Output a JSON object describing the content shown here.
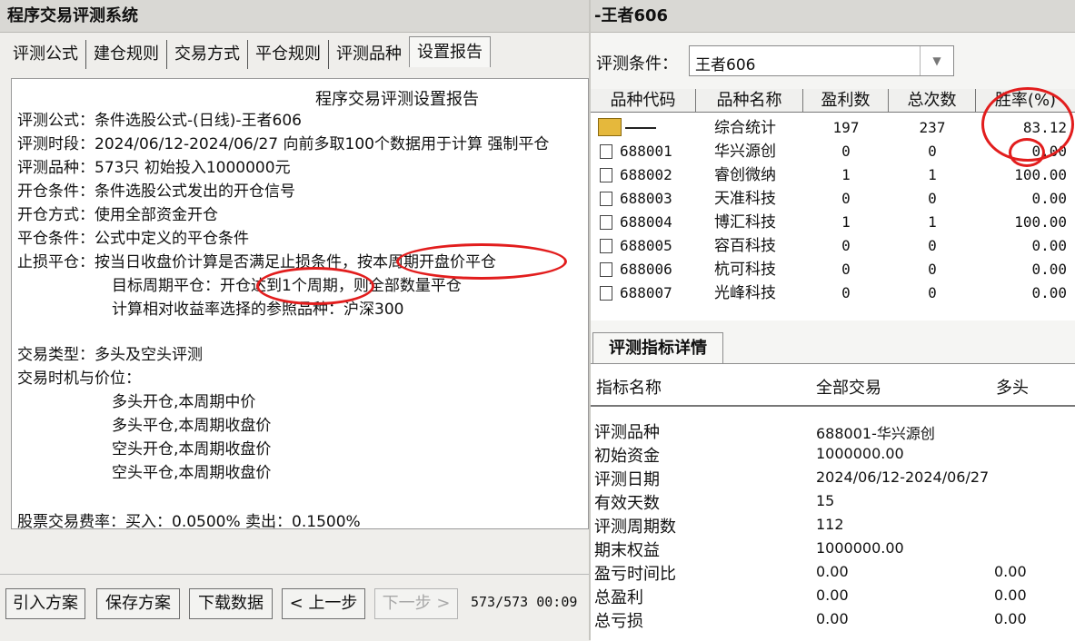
{
  "left_window": {
    "title": "程序交易评测系统",
    "tabs": [
      "评测公式",
      "建仓规则",
      "交易方式",
      "平仓规则",
      "评测品种",
      "设置报告"
    ],
    "report": {
      "title": "程序交易评测设置报告",
      "lines": [
        "评测公式：条件选股公式-(日线)-王者606",
        "评测时段：2024/06/12-2024/06/27 向前多取100个数据用于计算 强制平仓",
        "评测品种：573只 初始投入1000000元",
        "开仓条件：条件选股公式发出的开仓信号",
        "开仓方式：使用全部资金开仓",
        "平仓条件：公式中定义的平仓条件",
        "止损平仓：按当日收盘价计算是否满足止损条件，按本周期开盘价平仓",
        "目标周期平仓：开仓达到1个周期，则全部数量平仓",
        "计算相对收益率选择的参照品种：沪深300",
        "交易类型：多头及空头评测",
        "交易时机与价位：",
        "多头开仓,本周期中价",
        "多头平仓,本周期收盘价",
        "空头开仓,本周期收盘价",
        "空头平仓,本周期收盘价",
        "股票交易费率：买入：0.0500%  卖出：0.1500%"
      ]
    },
    "buttons": {
      "import": "引入方案",
      "save": "保存方案",
      "download": "下载数据",
      "prev": "< 上一步",
      "next": "下一步 >"
    },
    "progress": "573/573 00:09"
  },
  "right_window": {
    "title": "-王者606",
    "condition_label": "评测条件：",
    "condition_value": "王者606",
    "grid": {
      "headers": [
        "品种代码",
        "品种名称",
        "盈利数",
        "总次数",
        "胜率(%)"
      ],
      "rows": [
        {
          "code": "",
          "name": "综合统计",
          "profit": "197",
          "total": "237",
          "rate": "83.12"
        },
        {
          "code": "688001",
          "name": "华兴源创",
          "profit": "0",
          "total": "0",
          "rate": "0.00"
        },
        {
          "code": "688002",
          "name": "睿创微纳",
          "profit": "1",
          "total": "1",
          "rate": "100.00"
        },
        {
          "code": "688003",
          "name": "天准科技",
          "profit": "0",
          "total": "0",
          "rate": "0.00"
        },
        {
          "code": "688004",
          "name": "博汇科技",
          "profit": "1",
          "total": "1",
          "rate": "100.00"
        },
        {
          "code": "688005",
          "name": "容百科技",
          "profit": "0",
          "total": "0",
          "rate": "0.00"
        },
        {
          "code": "688006",
          "name": "杭可科技",
          "profit": "0",
          "total": "0",
          "rate": "0.00"
        },
        {
          "code": "688007",
          "name": "光峰科技",
          "profit": "0",
          "total": "0",
          "rate": "0.00"
        }
      ]
    },
    "detail": {
      "tab": "评测指标详情",
      "headers": [
        "指标名称",
        "全部交易",
        "多头"
      ],
      "rows": [
        {
          "name": "评测品种",
          "all": "688001-华兴源创",
          "long": ""
        },
        {
          "name": "初始资金",
          "all": "1000000.00",
          "long": ""
        },
        {
          "name": "评测日期",
          "all": "2024/06/12-2024/06/27",
          "long": ""
        },
        {
          "name": "有效天数",
          "all": "15",
          "long": ""
        },
        {
          "name": "评测周期数",
          "all": "112",
          "long": ""
        },
        {
          "name": "期末权益",
          "all": "1000000.00",
          "long": ""
        },
        {
          "name": "盈亏时间比",
          "all": "0.00",
          "long": "0.00"
        },
        {
          "name": "总盈利",
          "all": "0.00",
          "long": "0.00"
        },
        {
          "name": "总亏损",
          "all": "0.00",
          "long": "0.00"
        }
      ]
    }
  },
  "colors": {
    "annotation": "#e21d1d",
    "folder": "#e5b83c"
  }
}
